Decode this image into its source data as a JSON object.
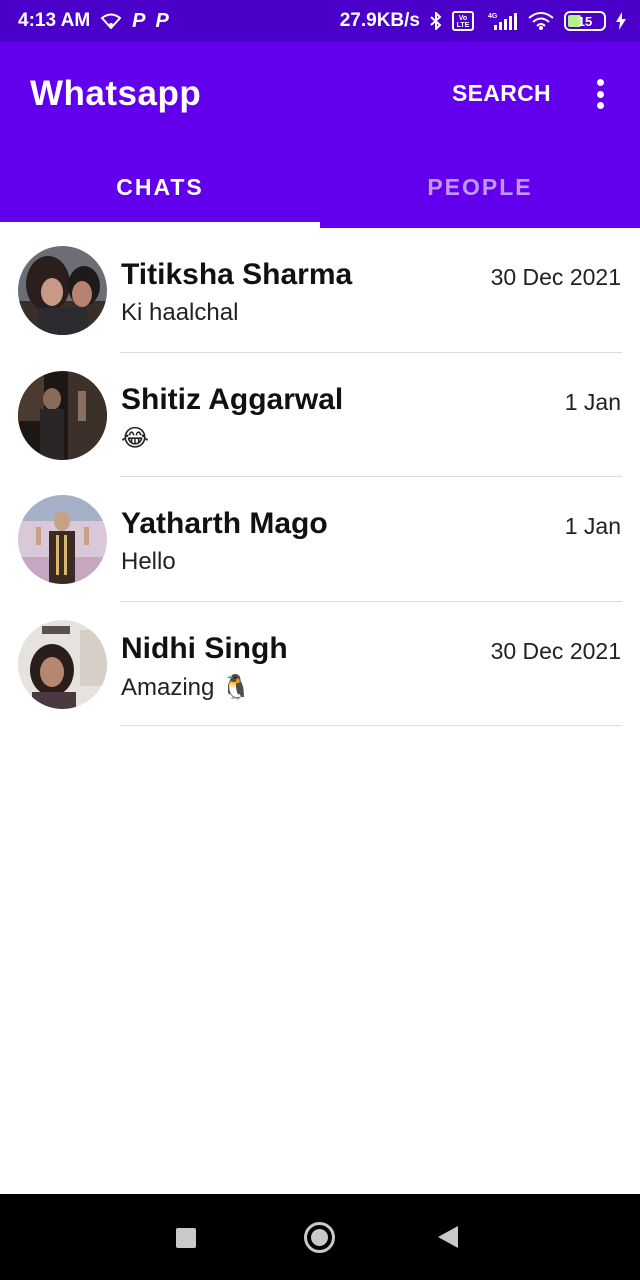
{
  "status_bar": {
    "time": "4:13 AM",
    "notification_letters": [
      "P",
      "P"
    ],
    "network_speed": "27.9KB/s",
    "volte_label": "Vo LTE",
    "network_type": "4G",
    "battery_level": "15",
    "icons": [
      "wifi-icon",
      "bluetooth-icon",
      "signal-icon",
      "charging-icon"
    ]
  },
  "app_bar": {
    "title": "Whatsapp",
    "search_label": "SEARCH",
    "menu_icon": "more-vert-icon",
    "background": "#6200ee"
  },
  "tabs": [
    {
      "label": "CHATS",
      "selected": true
    },
    {
      "label": "PEOPLE",
      "selected": false
    }
  ],
  "chats": [
    {
      "name": "Titiksha Sharma",
      "message": "Ki haalchal",
      "date": "30 Dec 2021"
    },
    {
      "name": "Shitiz Aggarwal",
      "message": "😂",
      "date": "1 Jan"
    },
    {
      "name": "Yatharth Mago",
      "message": "Hello",
      "date": "1 Jan"
    },
    {
      "name": "Nidhi Singh",
      "message": "Amazing 🐧",
      "date": "30 Dec 2021"
    }
  ],
  "nav_bar": {
    "icons": [
      "recent-apps-icon",
      "home-icon",
      "back-icon"
    ]
  }
}
